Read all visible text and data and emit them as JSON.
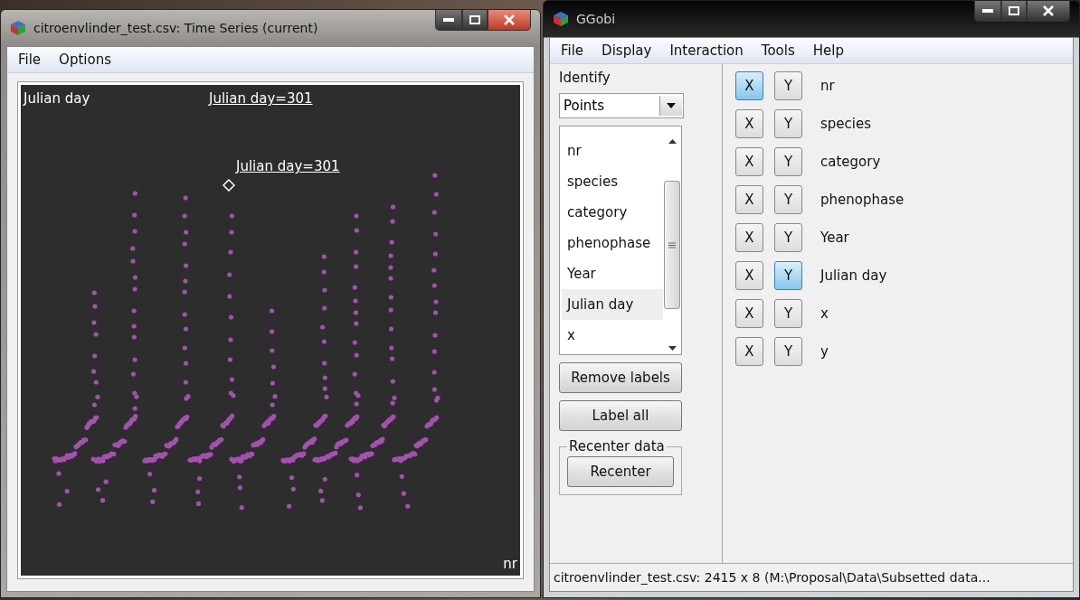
{
  "plot_window": {
    "title": "citroenvlinder_test.csv: Time Series (current)",
    "menu": [
      "File",
      "Options"
    ],
    "plot": {
      "y_variable": "Julian day",
      "x_variable": "nr",
      "hover_label": "Julian day=301",
      "point_label": "Julian day=301"
    }
  },
  "ggobi_window": {
    "title": "GGobi",
    "menu": [
      "File",
      "Display",
      "Interaction",
      "Tools",
      "Help"
    ],
    "identify": {
      "title": "Identify",
      "mode": "Points",
      "variables": [
        {
          "label": "nr",
          "selected": false
        },
        {
          "label": "species",
          "selected": false
        },
        {
          "label": "category",
          "selected": false
        },
        {
          "label": "phenophase",
          "selected": false
        },
        {
          "label": "Year",
          "selected": false
        },
        {
          "label": "Julian day",
          "selected": true
        },
        {
          "label": "x",
          "selected": false
        }
      ]
    },
    "buttons": [
      "Remove labels",
      "Label all"
    ],
    "recenter": {
      "title": "Recenter data",
      "button": "Recenter"
    },
    "variables": [
      {
        "name": "nr",
        "x": {
          "label": "X",
          "selected": true
        },
        "y": {
          "label": "Y",
          "selected": false
        }
      },
      {
        "name": "species",
        "x": {
          "label": "X",
          "selected": false
        },
        "y": {
          "label": "Y",
          "selected": false
        }
      },
      {
        "name": "category",
        "x": {
          "label": "X",
          "selected": false
        },
        "y": {
          "label": "Y",
          "selected": false
        }
      },
      {
        "name": "phenophase",
        "x": {
          "label": "X",
          "selected": false
        },
        "y": {
          "label": "Y",
          "selected": false
        }
      },
      {
        "name": "Year",
        "x": {
          "label": "X",
          "selected": false
        },
        "y": {
          "label": "Y",
          "selected": false
        }
      },
      {
        "name": "Julian day",
        "x": {
          "label": "X",
          "selected": false
        },
        "y": {
          "label": "Y",
          "selected": true
        }
      },
      {
        "name": "x",
        "x": {
          "label": "X",
          "selected": false
        },
        "y": {
          "label": "Y",
          "selected": false
        }
      },
      {
        "name": "y",
        "x": {
          "label": "X",
          "selected": false
        },
        "y": {
          "label": "Y",
          "selected": false
        }
      }
    ],
    "status_bar": "citroenvlinder_test.csv: 2415 x 8 (M:\\Proposal\\Data\\Subsetted data..."
  }
}
